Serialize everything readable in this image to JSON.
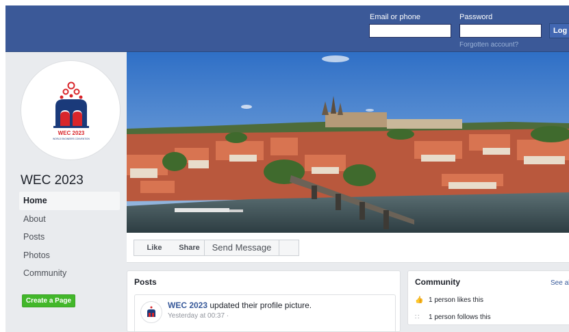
{
  "header": {
    "email_label": "Email or phone",
    "password_label": "Password",
    "forgot_link": "Forgotten account?",
    "login_button": "Log In",
    "colors": {
      "bar": "#3b5998",
      "button": "#4267b2"
    }
  },
  "profile": {
    "name": "WEC 2023",
    "logo_icon": "wec-2023-logo-icon",
    "logo_text": "WEC 2023",
    "logo_subtext": "WORLD ENGINEERS CONVENTION"
  },
  "sidebar": {
    "items": [
      {
        "label": "Home",
        "active": true
      },
      {
        "label": "About",
        "active": false
      },
      {
        "label": "Posts",
        "active": false
      },
      {
        "label": "Photos",
        "active": false
      },
      {
        "label": "Community",
        "active": false
      }
    ],
    "create_button": "Create a Page",
    "create_color": "#42b72a"
  },
  "actions": {
    "like": "Like",
    "share": "Share",
    "message": "Send Message"
  },
  "posts": {
    "title": "Posts",
    "items": [
      {
        "author": "WEC 2023",
        "text": " updated their profile picture.",
        "time": "Yesterday at 00:37 ·"
      }
    ]
  },
  "community": {
    "title": "Community",
    "see_all": "See all",
    "rows": [
      {
        "icon": "thumbs-up-icon",
        "text": "1 person likes this"
      },
      {
        "icon": "rss-icon",
        "text": "1 person follows this"
      }
    ]
  }
}
